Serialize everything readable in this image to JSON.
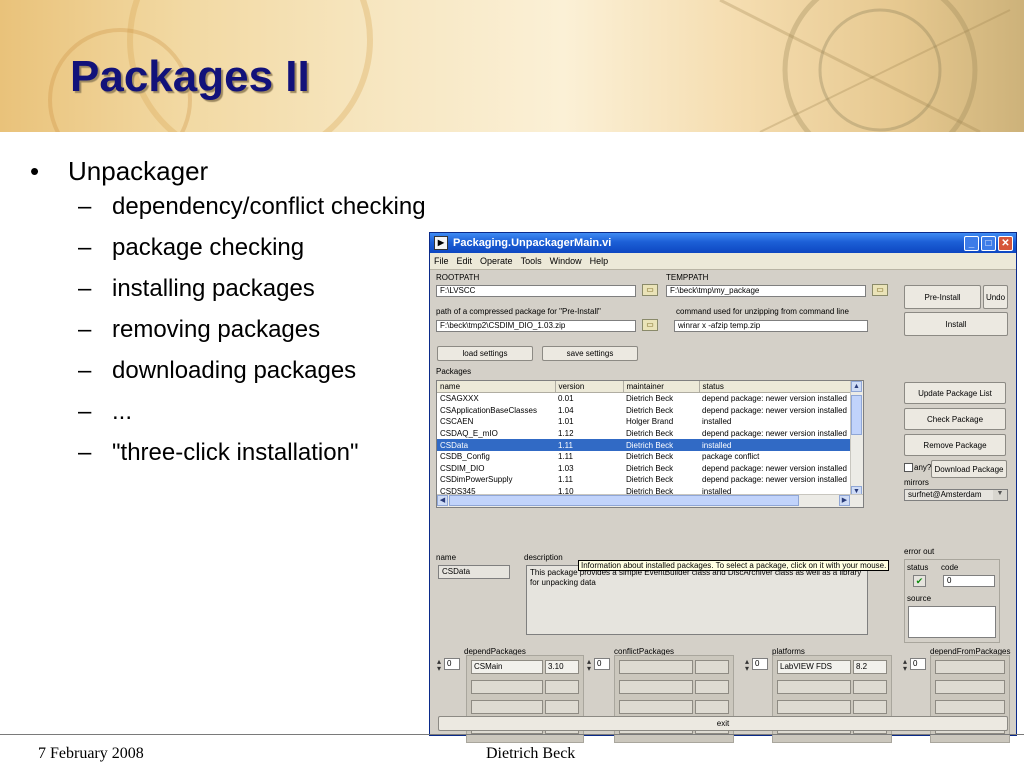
{
  "slide": {
    "title": "Packages II",
    "bullet": "Unpackager",
    "subbullets": [
      "dependency/conflict checking",
      "package checking",
      "installing packages",
      "removing packages",
      "downloading packages",
      "...",
      "\"three-click installation\""
    ],
    "footer_date": "7 February 2008",
    "footer_author": "Dietrich Beck"
  },
  "window": {
    "title": "Packaging.UnpackagerMain.vi",
    "menu": [
      "File",
      "Edit",
      "Operate",
      "Tools",
      "Window",
      "Help"
    ],
    "rootpath_label": "ROOTPATH",
    "rootpath_value": "F:\\LVSCC",
    "temppath_label": "TEMPPATH",
    "temppath_value": "F:\\beck\\tmp\\my_package",
    "zip_label": "path of a compressed package for \"Pre-Install\"",
    "zip_value": "F:\\beck\\tmp2\\CSDIM_DIO_1.03.zip",
    "cmd_label": "command used for unzipping from command line",
    "cmd_value": "winrar x -afzip temp.zip",
    "load_settings": "load settings",
    "save_settings": "save settings",
    "pre_install": "Pre-Install",
    "undo": "Undo",
    "install": "Install",
    "packages_label": "Packages",
    "columns": [
      "name",
      "version",
      "maintainer",
      "status"
    ],
    "rows": [
      [
        "CSAGXXX",
        "0.01",
        "Dietrich Beck",
        "depend package: newer version installed"
      ],
      [
        "CSApplicationBaseClasses",
        "1.04",
        "Dietrich Beck",
        "depend package: newer version installed"
      ],
      [
        "CSCAEN",
        "1.01",
        "Holger Brand",
        "installed"
      ],
      [
        "CSDAQ_E_mIO",
        "1.12",
        "Dietrich Beck",
        "depend package: newer version installed"
      ],
      [
        "CSData",
        "1.11",
        "Dietrich Beck",
        "installed"
      ],
      [
        "CSDB_Config",
        "1.11",
        "Dietrich Beck",
        "package conflict"
      ],
      [
        "CSDIM_DIO",
        "1.03",
        "Dietrich Beck",
        "depend package: newer version installed"
      ],
      [
        "CSDimPowerSupply",
        "1.11",
        "Dietrich Beck",
        "depend package: newer version installed"
      ],
      [
        "CSDS345",
        "1.10",
        "Dietrich Beck",
        "installed"
      ]
    ],
    "selected_row": 4,
    "update_list": "Update Package List",
    "check_package": "Check Package",
    "remove_package": "Remove Package",
    "any_label": "any?",
    "download_package": "Download Package",
    "mirrors_label": "mirrors",
    "mirrors_value": "surfnet@Amsterdam",
    "name_label": "name",
    "name_value": "CSData",
    "description_label": "description",
    "description_value": "This package provides a simple EventBuilder class and DiscArchiver class as well as a library for unpacking data",
    "tooltip": "Information about installed packages. To select a package, click on it with your mouse.",
    "error_out_label": "error out",
    "status_label": "status",
    "code_label": "code",
    "code_value": "0",
    "source_label": "source",
    "depend_label": "dependPackages",
    "depend_index": "0",
    "depend_name": "CSMain",
    "depend_version": "3.10",
    "conflict_label": "conflictPackages",
    "conflict_index": "0",
    "platforms_label": "platforms",
    "platforms_index": "0",
    "platform_name": "LabVIEW FDS",
    "platform_version": "8.2",
    "dependfrom_label": "dependFromPackages",
    "dependfrom_index": "0",
    "exit": "exit"
  }
}
